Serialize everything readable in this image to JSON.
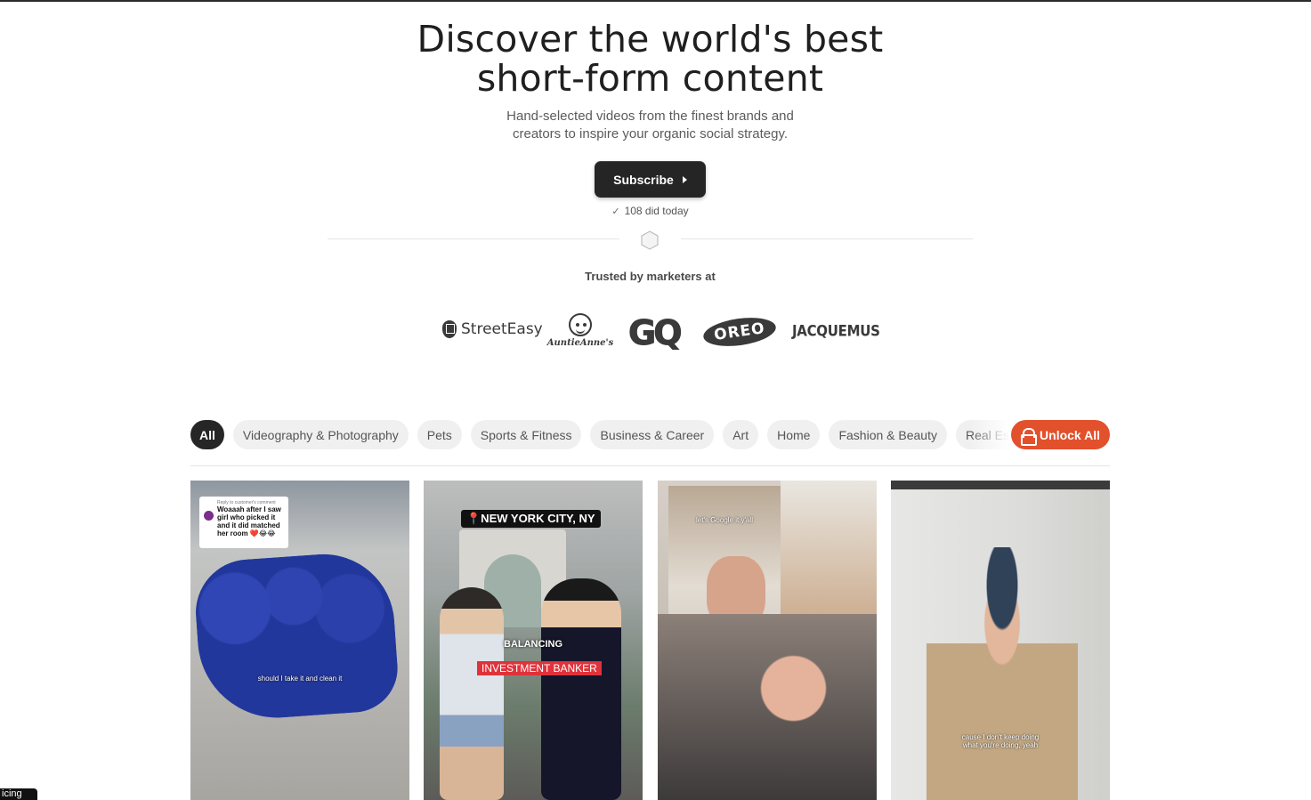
{
  "hero": {
    "title_line1": "Discover the world's best",
    "title_line2": "short-form content",
    "subtitle_line1": "Hand-selected videos from the finest brands and",
    "subtitle_line2": "creators to inspire your organic social strategy.",
    "subscribe_label": "Subscribe",
    "did_today": "108 did today"
  },
  "trusted": {
    "label": "Trusted by marketers at",
    "logos": [
      "StreetEasy",
      "AuntieAnne's",
      "GQ",
      "OREO",
      "JACQUEMUS"
    ]
  },
  "filters": {
    "chips": [
      "All",
      "Videography & Photography",
      "Pets",
      "Sports & Fitness",
      "Business & Career",
      "Art",
      "Home",
      "Fashion & Beauty",
      "Real Estate"
    ],
    "active": "All",
    "unlock_label": "Unlock All"
  },
  "videos": [
    {
      "comment_header": "Reply to customer's comment",
      "comment": "Woaaah after I saw girl who picked it and it did matched her room ❤️😂😂",
      "caption": "should I take it and clean it"
    },
    {
      "location": "📍NEW YORK CITY, NY",
      "caption_white": "BALANCING",
      "caption_red": "INVESTMENT BANKER"
    },
    {
      "caption": "let's Google it y'all"
    },
    {
      "caption_line1": "cause I don't keep doing",
      "caption_line2": "what you're doing, yeah"
    }
  ],
  "corner_tag": "icing",
  "colors": {
    "accent": "#e2502c",
    "dark_button": "#252525",
    "chip_bg": "#f0f0f0"
  }
}
